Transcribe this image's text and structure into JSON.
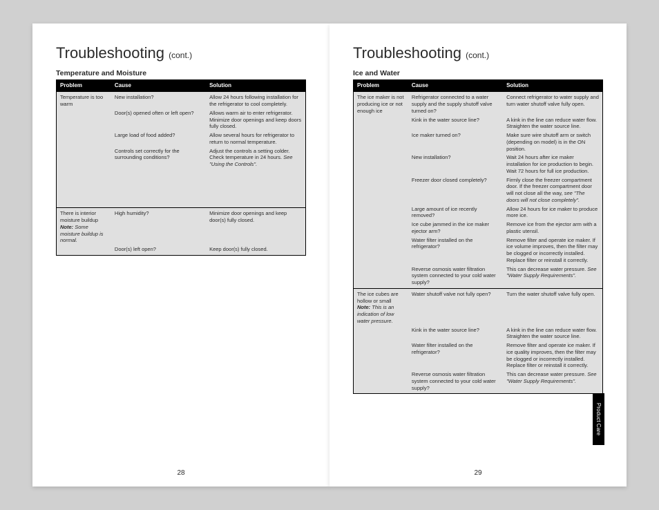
{
  "title_main": "Troubleshooting",
  "title_cont": "(cont.)",
  "tab_label": "Product Care",
  "left": {
    "section": "Temperature and Moisture",
    "headers": {
      "p": "Problem",
      "c": "Cause",
      "s": "Solution"
    },
    "pagenum": "28",
    "r1_problem": "Temperature is too warm",
    "r1_c1": "New installation?",
    "r1_s1": "Allow 24 hours following installation for the refrigerator to cool completely.",
    "r1_c2": "Door(s) opened often or left open?",
    "r1_s2": "Allows warm air to enter refrigerator. Minimize door openings and keep doors fully closed.",
    "r1_c3": "Large load of food added?",
    "r1_s3": "Allow several hours for refrigerator to return to normal temperature.",
    "r1_c4": "Controls set correctly for the surrounding conditions?",
    "r1_s4a": "Adjust the controls a setting colder. Check temperature in 24 hours. ",
    "r1_s4b": "See \"Using the Controls\".",
    "r2_p_a": "There is interior moisture buildup",
    "r2_p_note": "Note:",
    "r2_p_b": " Some moisture buildup is normal.",
    "r2_c1": "High humidity?",
    "r2_s1": "Minimize door openings and keep door(s) fully closed.",
    "r2_c2": "Door(s) left open?",
    "r2_s2": "Keep door(s) fully closed."
  },
  "right": {
    "section": "Ice and Water",
    "headers": {
      "p": "Problem",
      "c": "Cause",
      "s": "Solution"
    },
    "pagenum": "29",
    "r1_problem": "The ice maker is not producing ice or not enough ice",
    "r1_c1": "Refrigerator connected to a water supply and the supply shutoff valve turned on?",
    "r1_s1": "Connect refrigerator to water supply and turn water shutoff valve fully open.",
    "r1_c2": "Kink in the water source line?",
    "r1_s2": "A kink in the line can reduce water flow. Straighten the water source line.",
    "r1_c3": "Ice maker turned on?",
    "r1_s3": "Make sure wire shutoff arm or switch (depending on model) is in the ON position.",
    "r1_c4": "New installation?",
    "r1_s4": "Wait 24 hours after ice maker installation for ice production to begin. Wait 72 hours for full ice production.",
    "r1_c5": "Freezer door closed completely?",
    "r1_s5a": "Firmly close the freezer compartment door. If the freezer compartment door will not close all the way, ",
    "r1_s5b": "see \"The doors will not close completely\".",
    "r1_c6": "Large amount of ice recently removed?",
    "r1_s6": "Allow 24 hours for ice maker to produce more ice.",
    "r1_c7": "Ice cube jammed in the ice maker ejector arm?",
    "r1_s7": "Remove ice from the ejector arm with a plastic utensil.",
    "r1_c8": "Water filter installed on the refrigerator?",
    "r1_s8": "Remove filter and operate ice maker. If ice volume improves, then the filter may be clogged or incorrectly installed. Replace filter or reinstall it correctly.",
    "r1_c9": "Reverse osmosis water filtration system connected to your cold water supply?",
    "r1_s9a": "This can decrease water pressure. ",
    "r1_s9b": "See \"Water Supply Requirements\".",
    "r2_p_a": "The ice cubes are hollow or small",
    "r2_p_note": "Note:",
    "r2_p_b": " This is an indication of low water pressure.",
    "r2_c1": "Water shutoff valve not fully open?",
    "r2_s1": "Turn the water shutoff valve fully open.",
    "r2_c2": "Kink in the water source line?",
    "r2_s2": "A kink in the line can reduce water flow. Straighten the water source line.",
    "r2_c3": "Water filter installed on the refrigerator?",
    "r2_s3": "Remove filter and operate ice maker. If ice quality improves, then the filter may be clogged or incorrectly installed. Replace filter or reinstall it correctly.",
    "r2_c4": "Reverse osmosis water filtration system connected to your cold water supply?",
    "r2_s4a": "This can decrease water pressure. ",
    "r2_s4b": "See \"Water Supply Requirements\"."
  }
}
